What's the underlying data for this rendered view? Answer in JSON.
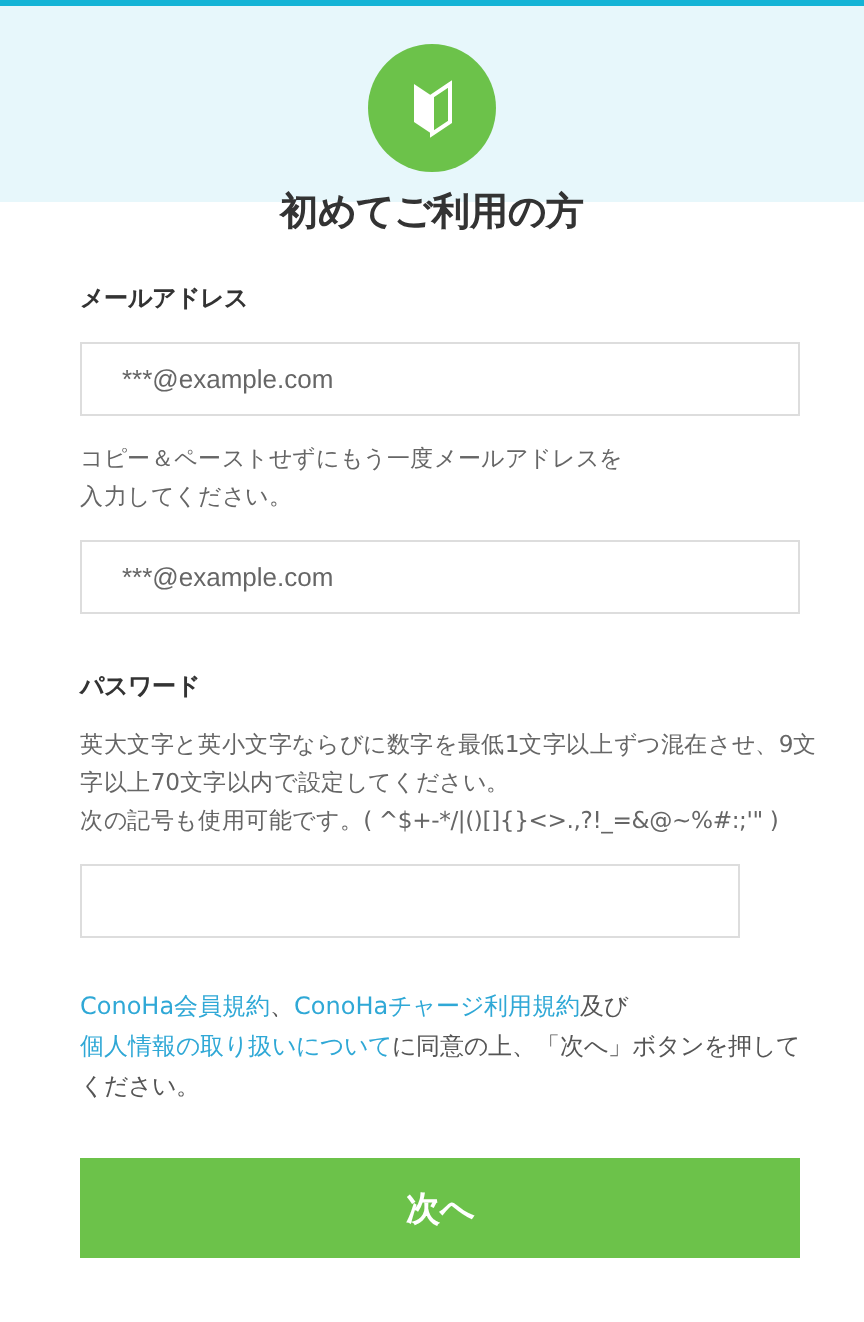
{
  "title": "初めてご利用の方",
  "email": {
    "label": "メールアドレス",
    "placeholder": "***@example.com"
  },
  "email_confirm": {
    "note_lines": [
      "コピー＆ペーストせずにもう一度メールアドレスを",
      "入力してください。"
    ],
    "placeholder": "***@example.com"
  },
  "password": {
    "label": "パスワード",
    "note_lines": [
      "英大文字と英小文字ならびに数字を最低1文字以上ずつ混在させ、9文字以上70文字以内で設定してください。",
      "次の記号も使用可能です。( ^$+-*/|()[]{}<>.,?!_=&@~%#:;'\" )"
    ]
  },
  "terms": [
    {
      "kind": "link",
      "text": "ConoHa会員規約"
    },
    {
      "kind": "text",
      "text": "、"
    },
    {
      "kind": "link",
      "text": "ConoHaチャージ利用規約"
    },
    {
      "kind": "text",
      "text": "及び"
    },
    {
      "kind": "link",
      "text": "個人情報の取り扱いについて"
    },
    {
      "kind": "text",
      "text": "に同意の上、「次へ」ボタンを押してください。"
    }
  ],
  "next_button": "次へ"
}
